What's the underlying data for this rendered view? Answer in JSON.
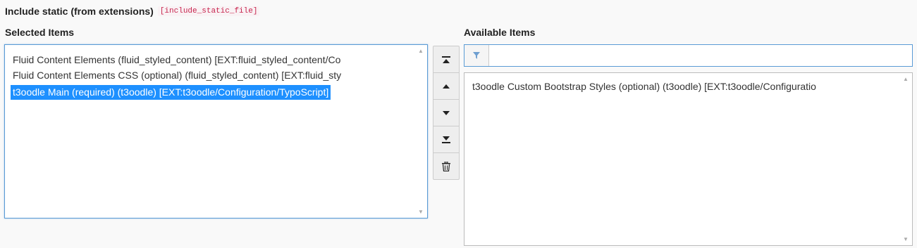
{
  "header": {
    "title": "Include static (from extensions)",
    "field_name": "[include_static_file]"
  },
  "selected": {
    "label": "Selected Items",
    "items": [
      "Fluid Content Elements (fluid_styled_content) [EXT:fluid_styled_content/Co",
      "Fluid Content Elements CSS (optional) (fluid_styled_content) [EXT:fluid_sty",
      "t3oodle Main (required) (t3oodle) [EXT:t3oodle/Configuration/TypoScript]"
    ],
    "active_index": 2
  },
  "buttons": {
    "move_top": "move-to-top-icon",
    "move_up": "move-up-icon",
    "move_down": "move-down-icon",
    "move_bottom": "move-to-bottom-icon",
    "remove": "trash-icon"
  },
  "available": {
    "label": "Available Items",
    "filter_value": "",
    "items": [
      "t3oodle Custom Bootstrap Styles (optional) (t3oodle) [EXT:t3oodle/Configuratio"
    ]
  },
  "colors": {
    "selection": "#1e90ff",
    "focus_border": "#5a9bd5",
    "field_name": "#c7254e"
  }
}
